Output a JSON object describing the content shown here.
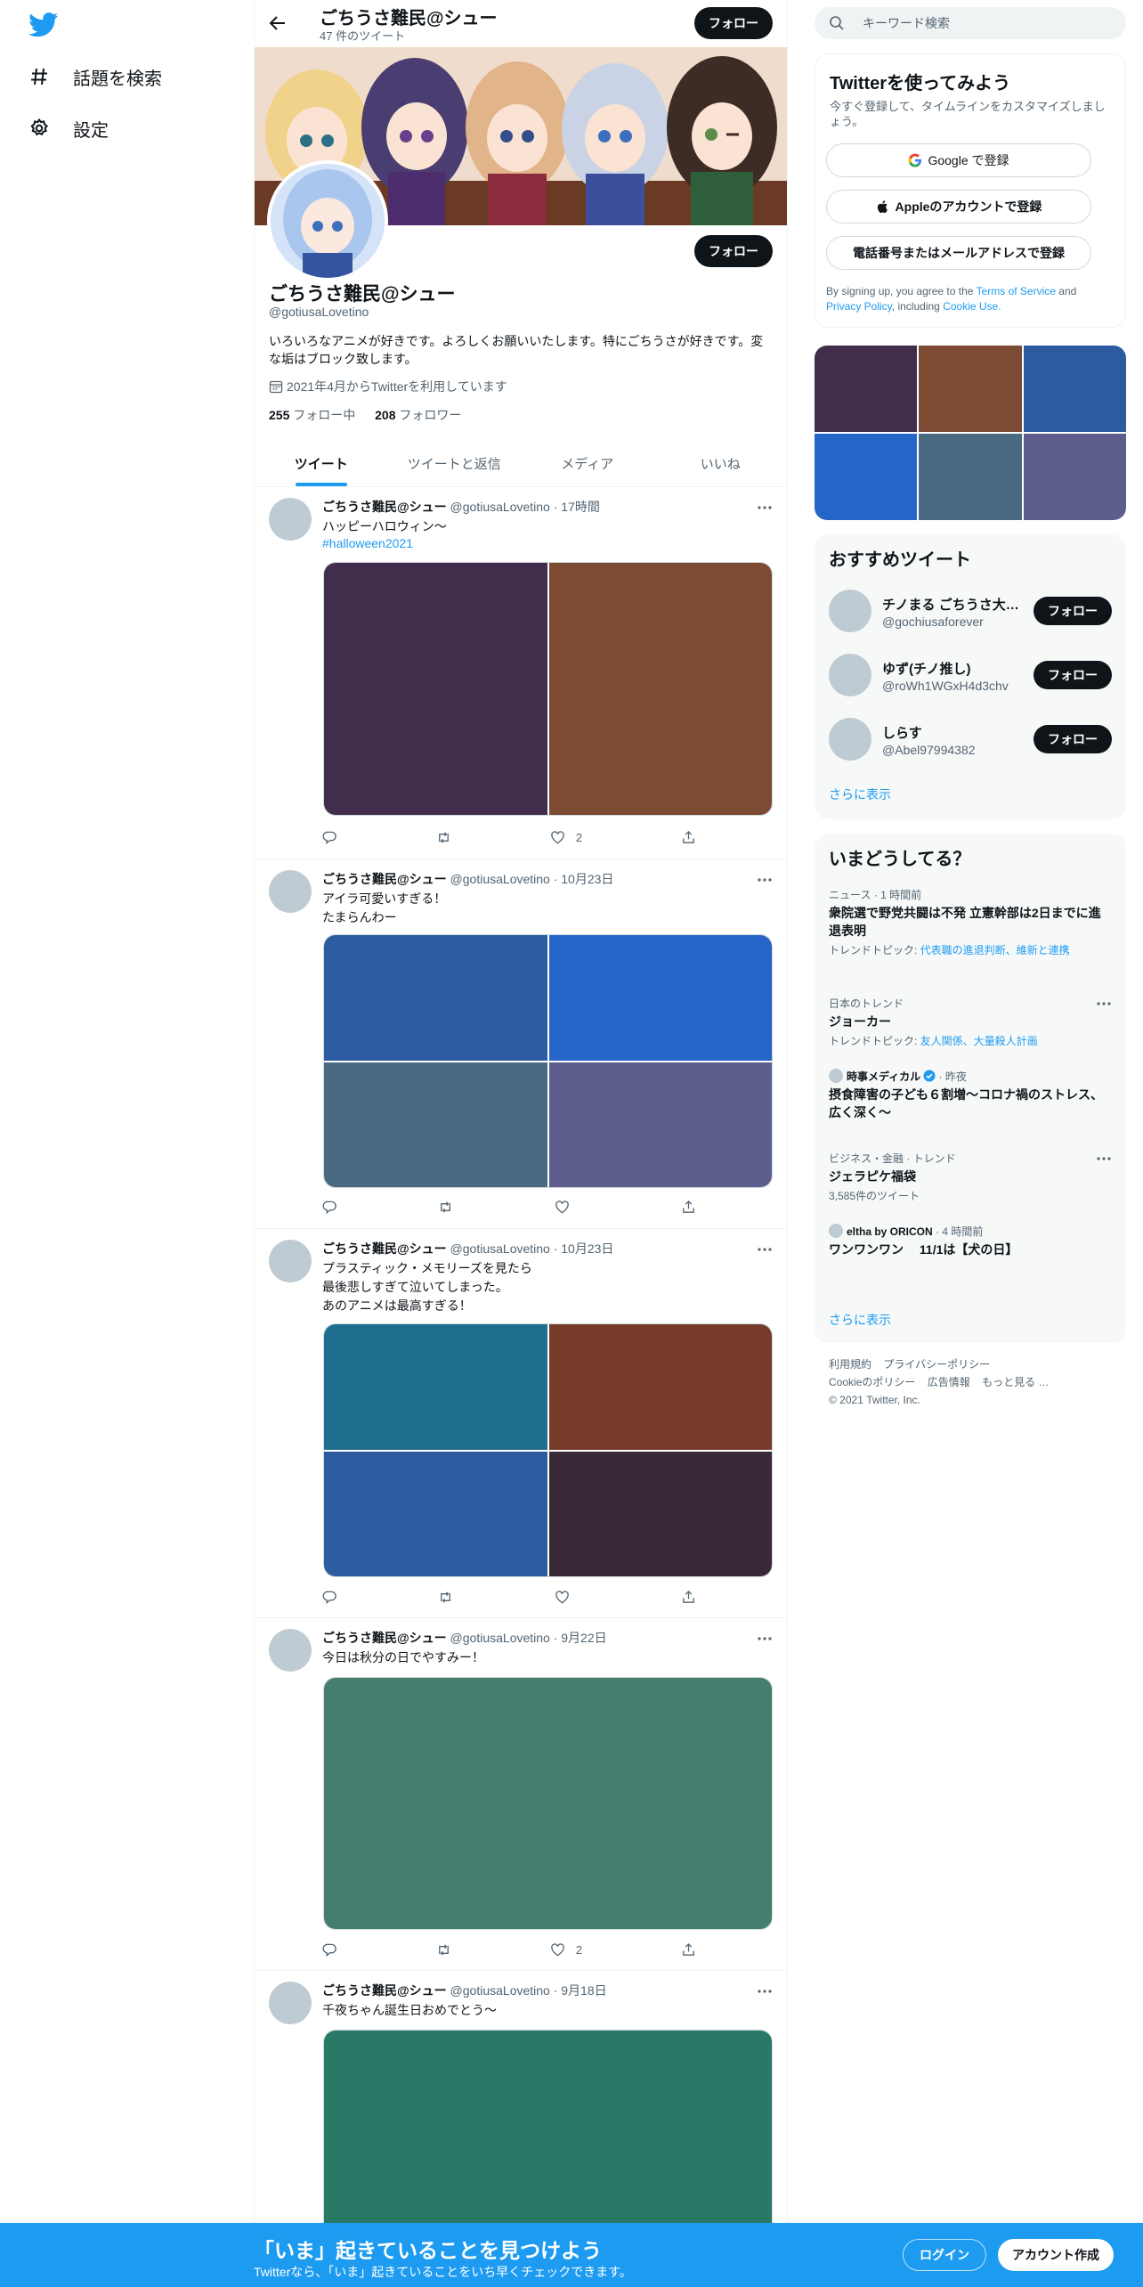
{
  "nav": {
    "items": [
      {
        "label": "話題を検索",
        "icon": "hashtag-icon"
      },
      {
        "label": "設定",
        "icon": "gear-icon"
      }
    ]
  },
  "header": {
    "name": "ごちうさ難民@シュー",
    "tweet_count": "47 件のツイート",
    "follow_label": "フォロー"
  },
  "profile": {
    "name": "ごちうさ難民@シュー",
    "handle": "@gotiusaLovetino",
    "bio": "いろいろなアニメが好きです。よろしくお願いいたします。特にごちうさが好きです。変な垢はブロック致します。",
    "joined": "2021年4月からTwitterを利用しています",
    "following_count": "255",
    "following_label": "フォロー中",
    "followers_count": "208",
    "followers_label": "フォロワー",
    "follow_label": "フォロー"
  },
  "tabs": [
    {
      "label": "ツイート",
      "active": true
    },
    {
      "label": "ツイートと返信",
      "active": false
    },
    {
      "label": "メディア",
      "active": false
    },
    {
      "label": "いいね",
      "active": false
    }
  ],
  "tweets": [
    {
      "name": "ごちうさ難民@シュー",
      "meta": "@gotiusaLovetino · 17時間",
      "text": "ハッピーハロウィン〜",
      "link": "#halloween2021",
      "like_count": "2"
    },
    {
      "name": "ごちうさ難民@シュー",
      "meta": "@gotiusaLovetino · 10月23日",
      "text": "アイラ可愛いすぎる！\nたまらんわー",
      "link": "",
      "like_count": ""
    },
    {
      "name": "ごちうさ難民@シュー",
      "meta": "@gotiusaLovetino · 10月23日",
      "text": "プラスティック・メモリーズを見たら\n最後悲しすぎて泣いてしまった。\nあのアニメは最高すぎる！",
      "link": "",
      "like_count": ""
    },
    {
      "name": "ごちうさ難民@シュー",
      "meta": "@gotiusaLovetino · 9月22日",
      "text": "今日は秋分の日でやすみー！",
      "link": "",
      "like_count": "2"
    },
    {
      "name": "ごちうさ難民@シュー",
      "meta": "@gotiusaLovetino · 9月18日",
      "text": "千夜ちゃん誕生日おめでとう〜",
      "link": "",
      "like_count": ""
    }
  ],
  "search": {
    "placeholder": "キーワード検索"
  },
  "signup": {
    "title": "Twitterを使ってみよう",
    "subtitle": "今すぐ登録して、タイムラインをカスタマイズしましょう。",
    "google": "Google で登録",
    "apple": "Appleのアカウントで登録",
    "phone": "電話番号またはメールアドレスで登録",
    "legal_prefix": "By signing up, you agree to the",
    "terms": "Terms of Service",
    "and": "and",
    "privacy": "Privacy Policy",
    "including": ", including",
    "cookie": "Cookie Use."
  },
  "recommend": {
    "title": "おすすめツイート",
    "users": [
      {
        "name": "チノまる ごちうさ大好き",
        "handle": "@gochiusaforever",
        "button": "フォロー"
      },
      {
        "name": "ゆず(チノ推し)",
        "handle": "@roWh1WGxH4d3chv",
        "button": "フォロー"
      },
      {
        "name": "しらす",
        "handle": "@Abel97994382",
        "button": "フォロー"
      }
    ],
    "show_more": "さらに表示"
  },
  "trends": {
    "title": "いまどうしてる？",
    "items": [
      {
        "meta": "ニュース · 1 時間前",
        "title": "衆院選で野党共闘は不発 立憲幹部は2日までに進退表明",
        "sub_prefix": "トレンドトピック: ",
        "sub_links": "代表職の進退判断、維新と連携"
      },
      {
        "meta": "日本のトレンド",
        "title": "ジョーカー",
        "sub_prefix": "トレンドトピック: ",
        "sub_links": "友人関係、大量殺人計画"
      },
      {
        "source": "時事メディカル",
        "meta": " · 昨夜",
        "title": "摂食障害の子ども６割増～コロナ禍のストレス、広く深く～"
      },
      {
        "meta": "ビジネス・金融 · トレンド",
        "title": "ジェラピケ福袋",
        "sub": "3,585件のツイート"
      },
      {
        "source": "eltha by ORICON",
        "meta": " · 4 時間前",
        "title": "ワンワンワン　 11/1は【犬の日】"
      }
    ],
    "show_more": "さらに表示"
  },
  "footer": {
    "links": [
      "利用規約",
      "プライバシーポリシー",
      "Cookieのポリシー",
      "広告情報",
      "もっと見る …"
    ],
    "copyright": "© 2021 Twitter, Inc."
  },
  "bottom_bar": {
    "title": "「いま」起きていることを見つけよう",
    "subtitle": "Twitterなら、「いま」起きていることをいち早くチェックできます。",
    "login": "ログイン",
    "signup": "アカウント作成"
  },
  "colors": {
    "accent": "#1d9bf0",
    "text": "#0f1419",
    "muted": "#536471",
    "media": [
      "#412d4c",
      "#7d4a34",
      "#2c5ba0",
      "#2665c8",
      "#4a6a82",
      "#5e5e8c",
      "#1f6e90",
      "#763a29",
      "#3a2a38",
      "#457d6e",
      "#287a66"
    ]
  }
}
